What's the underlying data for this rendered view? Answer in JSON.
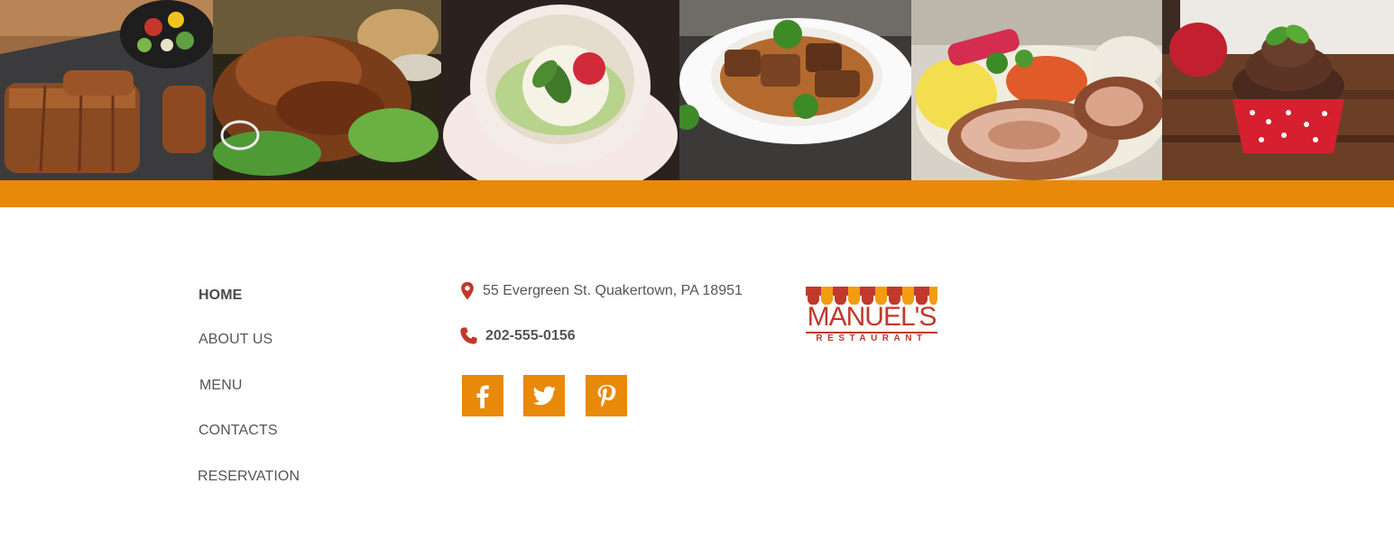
{
  "gallery": {
    "images": [
      {
        "name": "ribs-photo"
      },
      {
        "name": "roast-pork-photo"
      },
      {
        "name": "panna-cotta-photo"
      },
      {
        "name": "beef-stew-photo"
      },
      {
        "name": "rolled-roast-photo"
      },
      {
        "name": "cupcake-photo"
      }
    ]
  },
  "colors": {
    "accent": "#e8890a",
    "brand_red": "#c0392b",
    "text": "#555555"
  },
  "nav": {
    "items": [
      {
        "label": "HOME",
        "active": true
      },
      {
        "label": "ABOUT US",
        "active": false
      },
      {
        "label": "MENU",
        "active": false
      },
      {
        "label": "CONTACTS",
        "active": false
      },
      {
        "label": "RESERVATION",
        "active": false
      }
    ]
  },
  "contact": {
    "address": "55 Evergreen St. Quakertown, PA 18951",
    "phone": "202-555-0156",
    "address_icon": "map-pin-icon",
    "phone_icon": "phone-icon"
  },
  "social": [
    {
      "name": "facebook",
      "icon": "facebook-icon"
    },
    {
      "name": "twitter",
      "icon": "twitter-icon"
    },
    {
      "name": "pinterest",
      "icon": "pinterest-icon"
    }
  ],
  "logo": {
    "name": "MANUEL'S",
    "tagline": "RESTAURANT"
  }
}
